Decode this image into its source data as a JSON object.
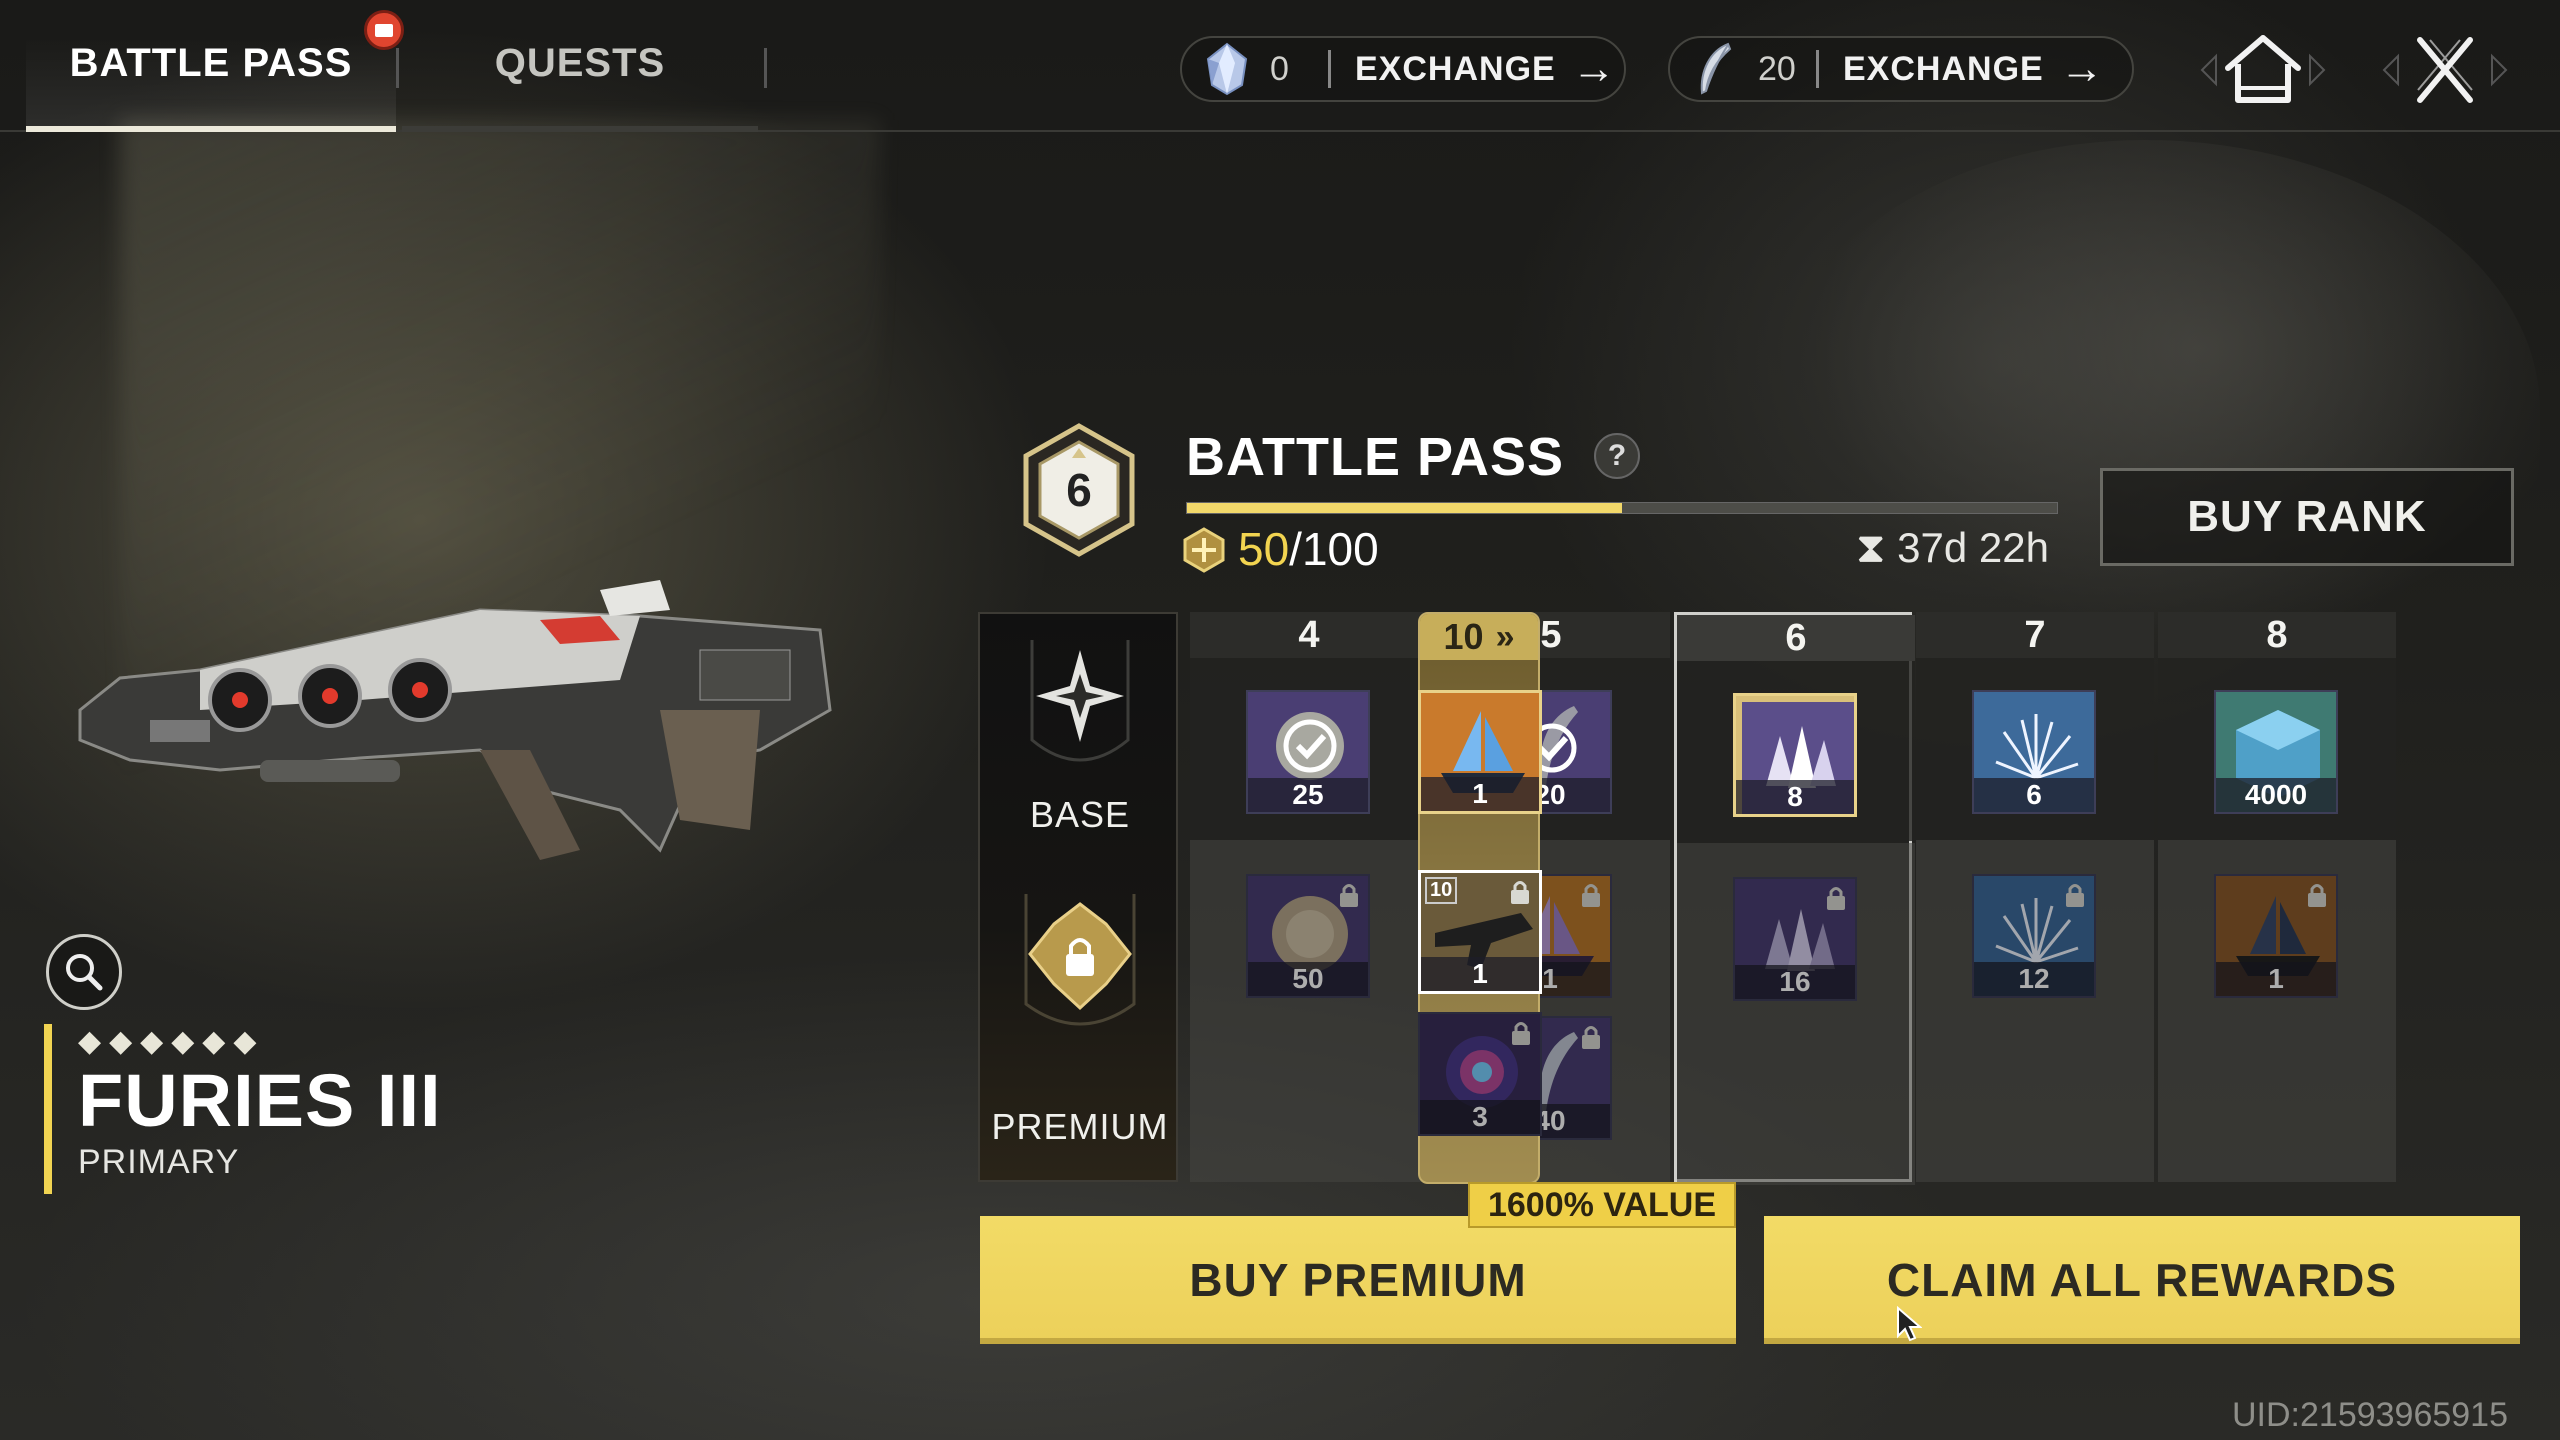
{
  "tabs": [
    {
      "label": "BATTLE PASS",
      "active": true,
      "notification": true
    },
    {
      "label": "QUESTS",
      "active": false
    }
  ],
  "currencies": [
    {
      "icon": "gem-icon",
      "amount": "0",
      "action": "EXCHANGE"
    },
    {
      "icon": "feather-icon",
      "amount": "20",
      "action": "EXCHANGE"
    }
  ],
  "nav": {
    "home_icon": "home-icon",
    "close_icon": "close-icon"
  },
  "weapon": {
    "stars": "◆◆◆◆◆◆",
    "name": "FURIES III",
    "type": "PRIMARY",
    "inspect_icon": "search-icon"
  },
  "battle_pass": {
    "rank": "6",
    "title": "BATTLE PASS",
    "help": "?",
    "xp_current": "50",
    "xp_total": "/100",
    "progress": 0.5,
    "timer": "37d 22h",
    "buy_rank_label": "BUY RANK"
  },
  "tracks": {
    "base_label": "BASE",
    "premium_label": "PREMIUM"
  },
  "ranks": [
    {
      "rank": "4",
      "base": [
        {
          "qty": "25",
          "art": "claimed-coin"
        }
      ],
      "premium": [
        {
          "qty": "50",
          "art": "fur",
          "locked": true
        }
      ]
    },
    {
      "rank": "5",
      "base": [
        {
          "qty": "20",
          "art": "claimed-feather"
        }
      ],
      "premium": [
        {
          "qty": "1",
          "art": "ship-purple",
          "locked": true
        },
        {
          "qty": "40",
          "art": "feather",
          "locked": true
        }
      ]
    },
    {
      "rank": "6",
      "current": true,
      "base": [
        {
          "qty": "8",
          "art": "crystals-gold"
        }
      ],
      "premium": [
        {
          "qty": "16",
          "art": "crystals",
          "locked": true
        }
      ]
    },
    {
      "rank": "7",
      "base": [
        {
          "qty": "6",
          "art": "spark"
        }
      ],
      "premium": [
        {
          "qty": "12",
          "art": "spark",
          "locked": true
        }
      ]
    },
    {
      "rank": "8",
      "base": [
        {
          "qty": "4000",
          "art": "cube"
        }
      ],
      "premium": [
        {
          "qty": "1",
          "art": "ship-dark",
          "locked": true
        }
      ]
    }
  ],
  "milestone": {
    "rank": "10",
    "chevron": "»",
    "base": [
      {
        "qty": "1",
        "art": "ship-blue"
      }
    ],
    "premium": [
      {
        "qty": "1",
        "art": "gun",
        "locked": true,
        "corner": "10"
      },
      {
        "qty": "3",
        "art": "orb",
        "locked": true
      }
    ]
  },
  "buttons": {
    "buy_premium": "BUY PREMIUM",
    "value_tag": "1600% VALUE",
    "claim_all": "CLAIM ALL REWARDS"
  },
  "uid": "UID:21593965915",
  "colors": {
    "accent": "#f2d86a",
    "button": "#ecd05a",
    "notification": "#e0452f"
  }
}
